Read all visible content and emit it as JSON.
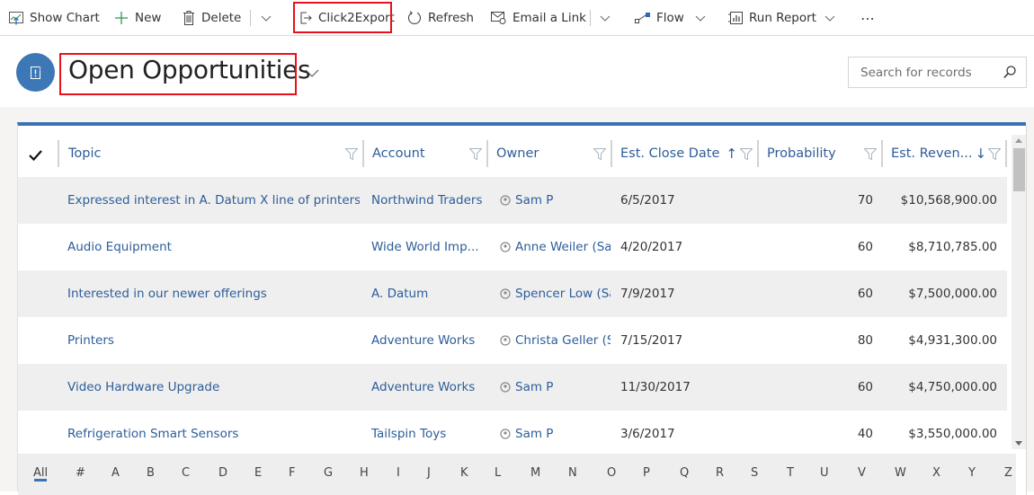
{
  "toolbar": {
    "show_chart": "Show Chart",
    "new": "New",
    "delete": "Delete",
    "click2export": "Click2Export",
    "refresh": "Refresh",
    "email_link": "Email a Link",
    "flow": "Flow",
    "run_report": "Run Report",
    "more": "⋯"
  },
  "header": {
    "title": "Open Opportunities",
    "search_placeholder": "Search for records"
  },
  "grid": {
    "columns": [
      {
        "label": "Topic",
        "sort": ""
      },
      {
        "label": "Account",
        "sort": ""
      },
      {
        "label": "Owner",
        "sort": ""
      },
      {
        "label": "Est. Close Date",
        "sort": "↑"
      },
      {
        "label": "Probability",
        "sort": ""
      },
      {
        "label": "Est. Reven...",
        "sort": "↓"
      }
    ],
    "rows": [
      {
        "topic": "Expressed interest in A. Datum X line of printers",
        "account": "Northwind Traders",
        "owner": "Sam P",
        "close_date": "6/5/2017",
        "probability": "70",
        "revenue": "$10,568,900.00"
      },
      {
        "topic": "Audio Equipment",
        "account": "Wide World Imp...",
        "owner": "Anne Weiler (Sa..",
        "close_date": "4/20/2017",
        "probability": "60",
        "revenue": "$8,710,785.00"
      },
      {
        "topic": "Interested in our newer offerings",
        "account": "A. Datum",
        "owner": "Spencer Low (Sa..",
        "close_date": "7/9/2017",
        "probability": "60",
        "revenue": "$7,500,000.00"
      },
      {
        "topic": "Printers",
        "account": "Adventure Works",
        "owner": "Christa Geller (Sa",
        "close_date": "7/15/2017",
        "probability": "80",
        "revenue": "$4,931,300.00"
      },
      {
        "topic": "Video Hardware Upgrade",
        "account": "Adventure Works",
        "owner": "Sam P",
        "close_date": "11/30/2017",
        "probability": "60",
        "revenue": "$4,750,000.00"
      },
      {
        "topic": "Refrigeration Smart Sensors",
        "account": "Tailspin Toys",
        "owner": "Sam P",
        "close_date": "3/6/2017",
        "probability": "40",
        "revenue": "$3,550,000.00"
      }
    ]
  },
  "alpha_filter": {
    "items": [
      "All",
      "#",
      "A",
      "B",
      "C",
      "D",
      "E",
      "F",
      "G",
      "H",
      "I",
      "J",
      "K",
      "L",
      "M",
      "N",
      "O",
      "P",
      "Q",
      "R",
      "S",
      "T",
      "U",
      "V",
      "W",
      "X",
      "Y",
      "Z"
    ],
    "active": "All"
  },
  "colors": {
    "accent": "#3a73b3",
    "link": "#2d5d99",
    "highlight": "#e8111b",
    "row_alt": "#efefef"
  }
}
